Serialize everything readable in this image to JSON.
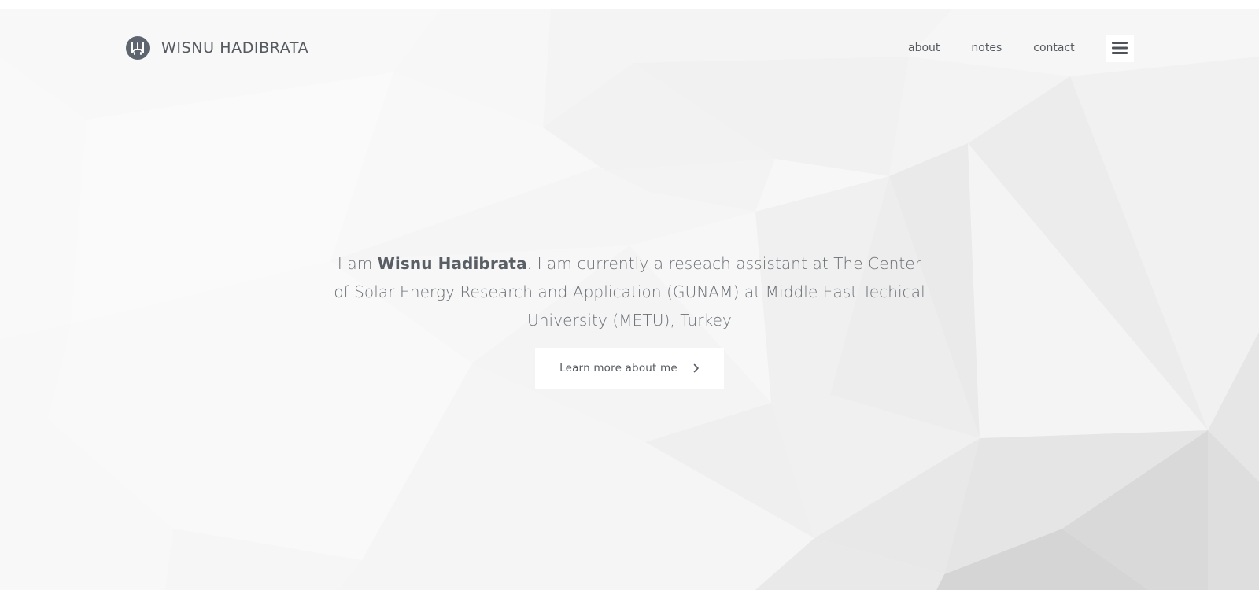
{
  "brand": {
    "name": "WISNU HADIBRATA",
    "logo_icon": "wh-monogram-icon",
    "logo_color": "#5f656e"
  },
  "nav": {
    "items": [
      {
        "label": "about"
      },
      {
        "label": "notes"
      },
      {
        "label": "contact"
      }
    ],
    "menu_icon": "hamburger-icon"
  },
  "intro": {
    "prefix": "I am ",
    "name": "Wisnu Hadibrata",
    "rest": ". I am currently a reseach assistant at The Center of Solar Energy Research and Application (GUNAM) at Middle East Techical University (METU), Turkey"
  },
  "cta": {
    "label": "Learn more about me",
    "icon": "chevron-right-icon"
  },
  "colors": {
    "text": "#555a60",
    "background": "#f7f7f7",
    "button_bg": "#ffffff"
  }
}
